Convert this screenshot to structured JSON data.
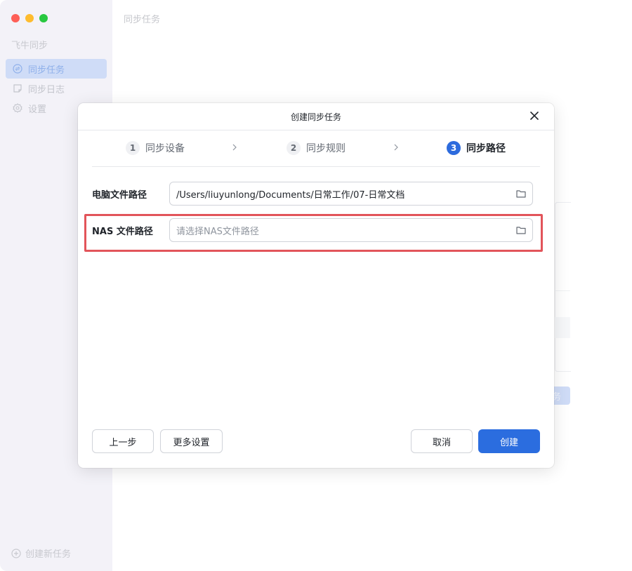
{
  "sidebar": {
    "app_title": "飞牛同步",
    "items": [
      {
        "label": "同步任务",
        "icon": "sync-circle-icon",
        "active": true
      },
      {
        "label": "同步日志",
        "icon": "log-note-icon",
        "active": false
      },
      {
        "label": "设置",
        "icon": "gear-icon",
        "active": false
      }
    ],
    "new_task_label": "创建新任务"
  },
  "main": {
    "title": "同步任务",
    "bg_button_fragment": "务"
  },
  "modal": {
    "title": "创建同步任务",
    "steps": [
      {
        "number": "1",
        "label": "同步设备",
        "active": false
      },
      {
        "number": "2",
        "label": "同步规则",
        "active": false
      },
      {
        "number": "3",
        "label": "同步路径",
        "active": true
      }
    ],
    "fields": {
      "pc_path": {
        "label": "电脑文件路径",
        "value": "/Users/liuyunlong/Documents/日常工作/07-日常文档"
      },
      "nas_path": {
        "label": "NAS 文件路径",
        "placeholder": "请选择NAS文件路径"
      }
    },
    "buttons": {
      "prev": "上一步",
      "more_settings": "更多设置",
      "cancel": "取消",
      "create": "创建"
    }
  },
  "colors": {
    "accent": "#2b6ddf",
    "highlight": "#e2545a",
    "sidebar_bg": "#f3f2f8"
  }
}
